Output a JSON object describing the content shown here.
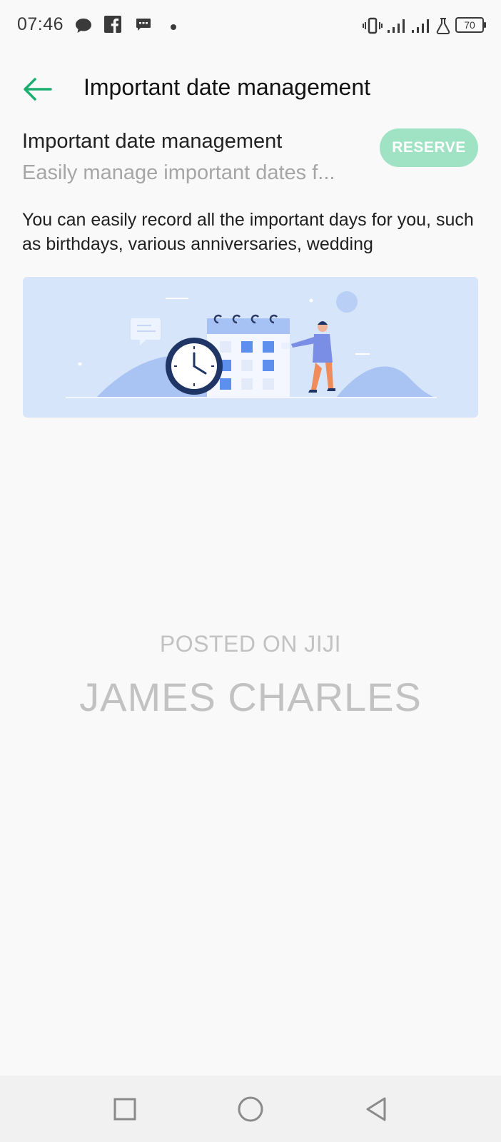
{
  "status_bar": {
    "time": "07:46",
    "left_icons": [
      "chat-bubble-icon",
      "facebook-icon",
      "message-icon",
      "dot-icon"
    ],
    "right_icons": [
      "vibrate-icon",
      "signal-icon",
      "signal-icon",
      "lab-flask-icon"
    ],
    "battery": "70"
  },
  "header": {
    "back_icon": "arrow-left-icon",
    "title": "Important date management"
  },
  "feature": {
    "title": "Important date management",
    "subtitle": "Easily manage important dates f...",
    "reserve_label": "RESERVE",
    "description": "You can easily record all the important days for you, such as birthdays, various anniversaries, wedding"
  },
  "watermark": {
    "line1": "POSTED ON JIJI",
    "line2": "JAMES CHARLES"
  },
  "nav_bar": {
    "icons": [
      "recents-square-icon",
      "home-circle-icon",
      "back-triangle-icon"
    ]
  },
  "colors": {
    "accent_green": "#1aae6f",
    "reserve_bg": "#9fe3c4",
    "illustration_bg": "#d7e5fb"
  }
}
